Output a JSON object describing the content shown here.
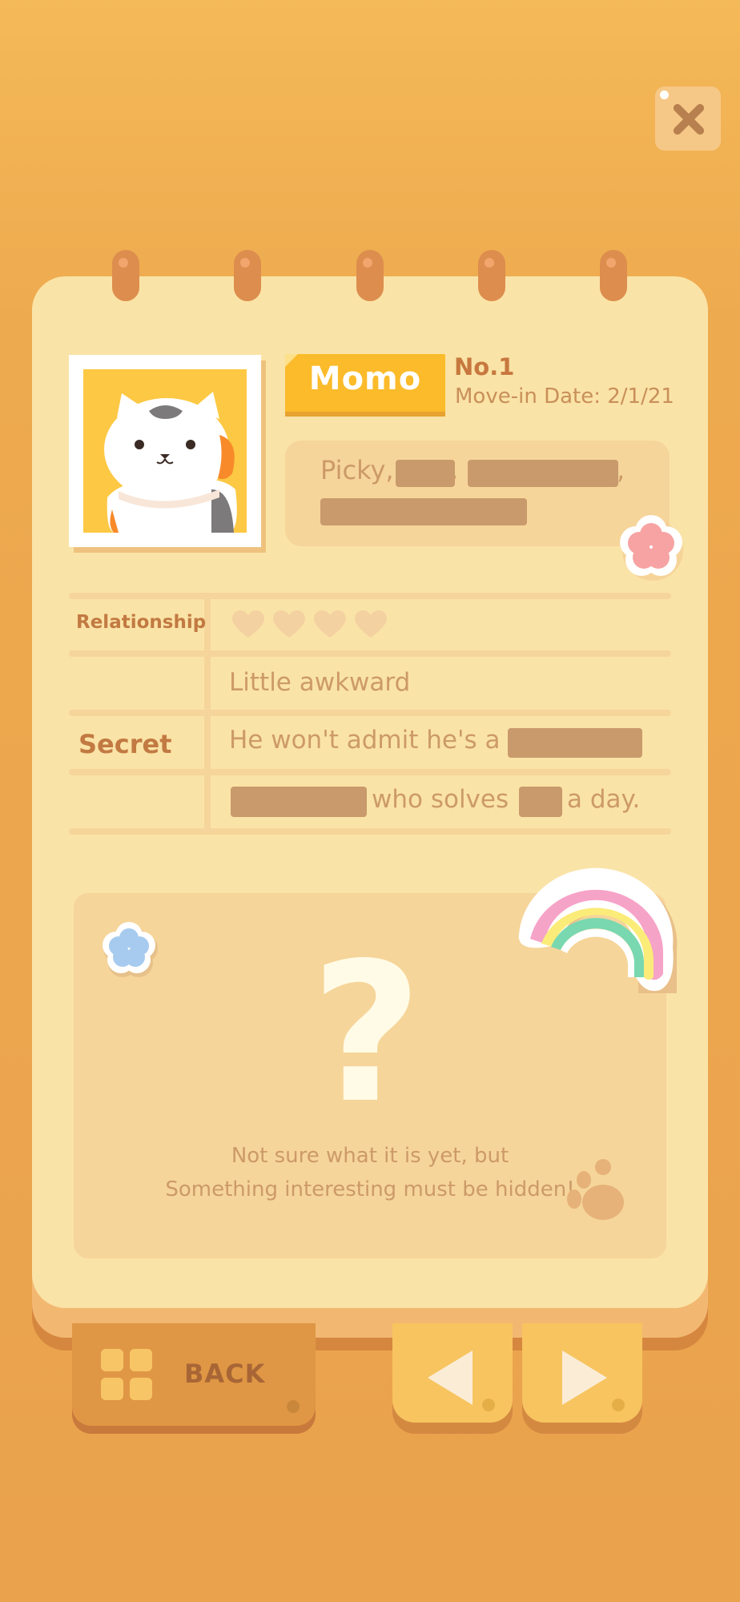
{
  "close_button": {
    "icon": "close-icon"
  },
  "profile": {
    "name": "Momo",
    "number": "No.1",
    "move_in": "Move-in Date: 2/1/21",
    "traits_visible": "Picky,",
    "traits_separator": ",",
    "traits_trailing": ","
  },
  "table": {
    "relationship_label": "Relationship",
    "relationship_level": 0,
    "relationship_max": 4,
    "relationship_text": "Little awkward",
    "secret_label": "Secret",
    "secret_line1": "He won't admit he's a",
    "secret_line2_a": "who solves",
    "secret_line2_b": "a day."
  },
  "mystery": {
    "symbol": "?",
    "line1": "Not sure what it is yet, but",
    "line2": "Something interesting must be hidden!"
  },
  "bottom_bar": {
    "back_label": "BACK",
    "prev_icon": "arrow-left-icon",
    "next_icon": "arrow-right-icon"
  },
  "colors": {
    "background": "#eeaa4f",
    "card": "#fae3a7",
    "name_plate": "#fbbb2a",
    "accent_text": "#c27a42"
  }
}
